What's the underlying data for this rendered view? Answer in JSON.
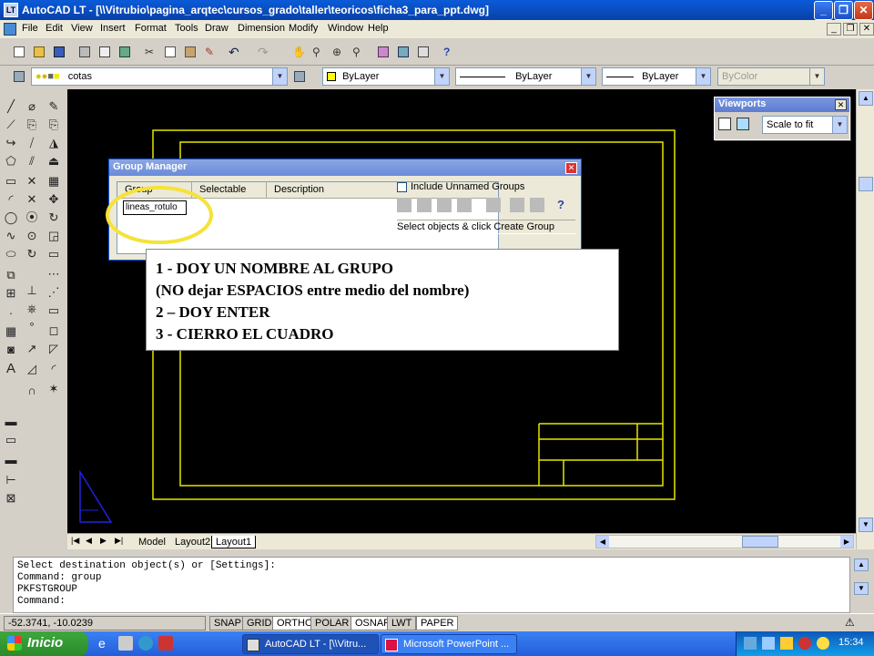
{
  "window": {
    "app_icon": "LT",
    "title": "AutoCAD LT - [\\\\Vitrubio\\pagina_arqtec\\cursos_grado\\taller\\teoricos\\ficha3_para_ppt.dwg]",
    "minimize": "_",
    "restore": "❐",
    "close": "✕"
  },
  "menu": {
    "items": [
      "File",
      "Edit",
      "View",
      "Insert",
      "Format",
      "Tools",
      "Draw",
      "Dimension",
      "Modify",
      "Window",
      "Help"
    ]
  },
  "layers": {
    "current_layer": "cotas",
    "color": "ByLayer",
    "linetype": "ByLayer",
    "lineweight": "ByLayer",
    "plotstyle": "ByColor"
  },
  "viewports_panel": {
    "title": "Viewports",
    "scale": "Scale to fit"
  },
  "group_manager": {
    "title": "Group Manager",
    "columns": [
      "Group",
      "Selectable",
      "Description"
    ],
    "entry_value": "lineas_rotulo",
    "include_unnamed": "Include Unnamed Groups",
    "hint": "Select objects & click Create Group"
  },
  "instructions": {
    "line1": "1 - DOY UN NOMBRE AL GRUPO",
    "line2": "(NO dejar ESPACIOS entre medio del nombre)",
    "line3": "2 – DOY ENTER",
    "line4": "3 - CIERRO EL CUADRO"
  },
  "layout_tabs": [
    "Model",
    "Layout2",
    "Layout1"
  ],
  "command_lines": [
    "Select destination object(s) or [Settings]:",
    "Command: group",
    "PKFSTGROUP",
    "Command:"
  ],
  "status": {
    "coords": "-52.3741, -10.0239",
    "toggles": [
      "SNAP",
      "GRID",
      "ORTHO",
      "POLAR",
      "OSNAP",
      "LWT",
      "PAPER"
    ]
  },
  "taskbar": {
    "start": "Inicio",
    "tasks": [
      "AutoCAD LT - [\\\\Vitru...",
      "Microsoft PowerPoint ..."
    ],
    "time": "15:34"
  },
  "colors": {
    "drawing_bg": "#000000",
    "frame_line": "#e6e600",
    "highlight_ellipse": "#f5e23a",
    "triangle": "#2222dd"
  }
}
